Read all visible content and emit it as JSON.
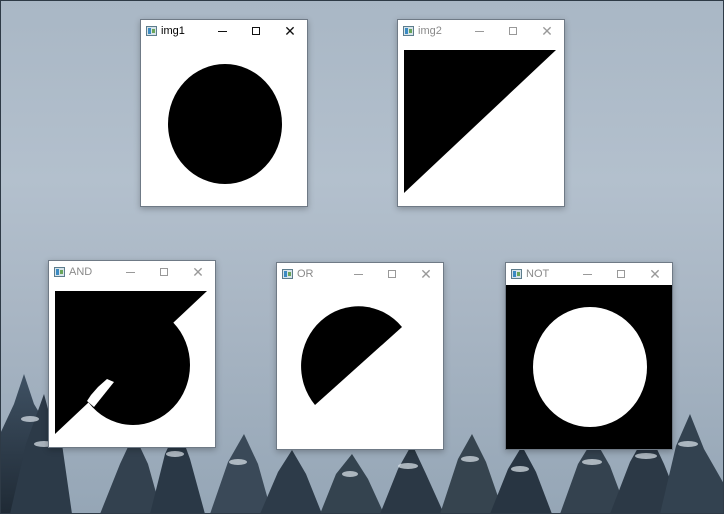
{
  "windows": [
    {
      "id": "img1",
      "title": "img1",
      "active": true,
      "image": "filled black circle on white"
    },
    {
      "id": "img2",
      "title": "img2",
      "active": false,
      "image": "black triangle on white"
    },
    {
      "id": "and",
      "title": "AND",
      "active": false,
      "image": "bitwise AND result"
    },
    {
      "id": "or",
      "title": "OR",
      "active": false,
      "image": "bitwise OR result"
    },
    {
      "id": "not",
      "title": "NOT",
      "active": false,
      "image": "white circle on black"
    }
  ],
  "controls": {
    "minimize_icon": "minimize-icon",
    "maximize_icon": "maximize-icon",
    "close_icon": "close-icon"
  },
  "colors": {
    "black": "#000000",
    "white": "#ffffff",
    "titlebar": "#ffffff"
  }
}
